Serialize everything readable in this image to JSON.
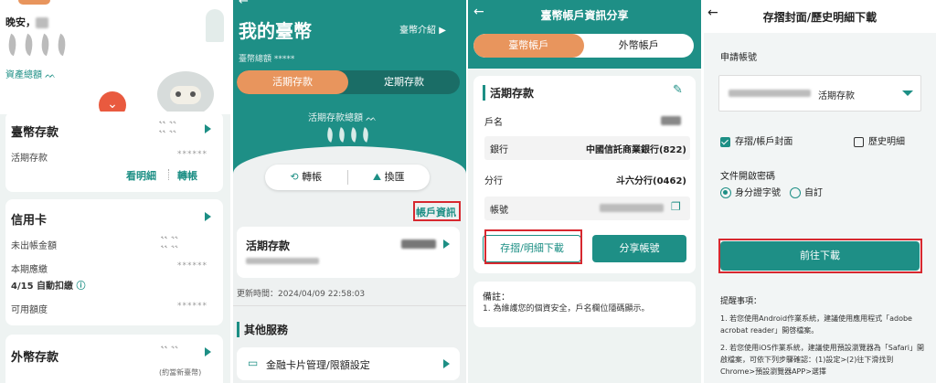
{
  "colors": {
    "teal": "#1d8f85",
    "orange": "#e8955d",
    "red_highlight": "#d7282f"
  },
  "panel1": {
    "greeting": "晚安，",
    "assets_label": "資產總額",
    "twd": {
      "title": "臺幣存款",
      "sub": "活期存款",
      "masked": "******",
      "link_detail": "看明細",
      "link_transfer": "轉帳"
    },
    "credit": {
      "title": "信用卡",
      "unbilled": "未出帳金額",
      "due": "本期應繳",
      "autopay": "4/15 自動扣繳",
      "available": "可用額度",
      "masked": "******"
    },
    "foreign": {
      "title": "外幣存款",
      "note": "(約當新臺幣)"
    }
  },
  "panel2": {
    "title": "我的臺幣",
    "intro_link": "臺幣介紹",
    "total_label": "臺幣總額",
    "total_masked": "*****",
    "tabs": [
      "活期存款",
      "定期存款"
    ],
    "balance_label": "活期存款總額",
    "btn_transfer": "轉帳",
    "btn_exchange": "換匯",
    "account_info": "帳戶資訊",
    "account_card_title": "活期存款",
    "update_time": "更新時間：2024/04/09 22:58:03",
    "other_services": "其他服務",
    "service_item": "金融卡片管理/限額設定"
  },
  "panel3": {
    "title": "臺幣帳戶資訊分享",
    "tabs": [
      "臺幣帳戶",
      "外幣帳戶"
    ],
    "section": "活期存款",
    "rows": [
      {
        "label": "戶名",
        "value": ""
      },
      {
        "label": "銀行",
        "value": "中國信託商業銀行(822)"
      },
      {
        "label": "分行",
        "value": "斗六分行(0462)"
      },
      {
        "label": "帳號",
        "value": ""
      }
    ],
    "btn_download": "存摺/明細下載",
    "btn_share": "分享帳號",
    "note_title": "備註：",
    "note_text": "1. 為維護您的個資安全，戶名欄位隱碼顯示。"
  },
  "panel4": {
    "title": "存摺封面/歷史明細下載",
    "apply_label": "申請帳號",
    "account_suffix": "活期存款",
    "chk_cover": "存摺/帳戶封面",
    "chk_history": "歷史明細",
    "pwd_label": "文件開啟密碼",
    "radio_id": "身分證字號",
    "radio_custom": "自訂",
    "btn_go": "前往下載",
    "notice_title": "提醒事項：",
    "notice1": "1. 若您使用Android作業系統，建議使用應用程式「adobe acrobat reader」開啓檔案。",
    "notice2": "2. 若您使用iOS作業系統，建議使用預設瀏覽器為「Safari」開啟檔案，可依下列步驟確認：(1)設定>(2)往下滑找到Chrome>預設瀏覽器APP>選擇"
  }
}
